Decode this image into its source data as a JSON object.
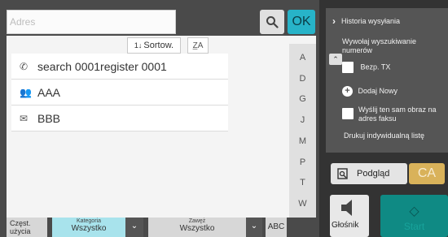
{
  "address": {
    "placeholder": "Adres"
  },
  "toolbar": {
    "sort_label": "Sortow.",
    "sort_glyph": "1↓",
    "az_glyph": "Z̲A",
    "ok_label": "OK"
  },
  "entries": [
    {
      "icon": "phone-icon",
      "glyph": "✆",
      "label": "search 0001register 0001"
    },
    {
      "icon": "group-icon",
      "glyph": "👥",
      "label": "AAA"
    },
    {
      "icon": "email-icon",
      "glyph": "✉",
      "label": "BBB"
    }
  ],
  "alpha_index": [
    "A",
    "D",
    "G",
    "J",
    "M",
    "P",
    "T",
    "W"
  ],
  "bottom_tabs": {
    "frequent": "Częst. użycia",
    "category_label": "Kategoria",
    "category_value": "Wszystko",
    "narrow_label": "Zawęż",
    "narrow_value": "Wszystko",
    "abc": "ABC"
  },
  "side": {
    "history": "Historia wysyłania",
    "number_search": "Wywołaj wyszukiwanie numerów",
    "direct_tx": "Bezp. TX",
    "add_new": "Dodaj Nowy",
    "send_same": "Wyślij ten sam obraz na adres faksu",
    "print_individual": "Drukuj indywidualną listę",
    "preview": "Podgląd",
    "ca": "CA",
    "speaker": "Głośnik",
    "start": "Start"
  },
  "colors": {
    "ok": "#27b3c8",
    "ca": "#d9b25a",
    "start": "#0f8a84"
  }
}
